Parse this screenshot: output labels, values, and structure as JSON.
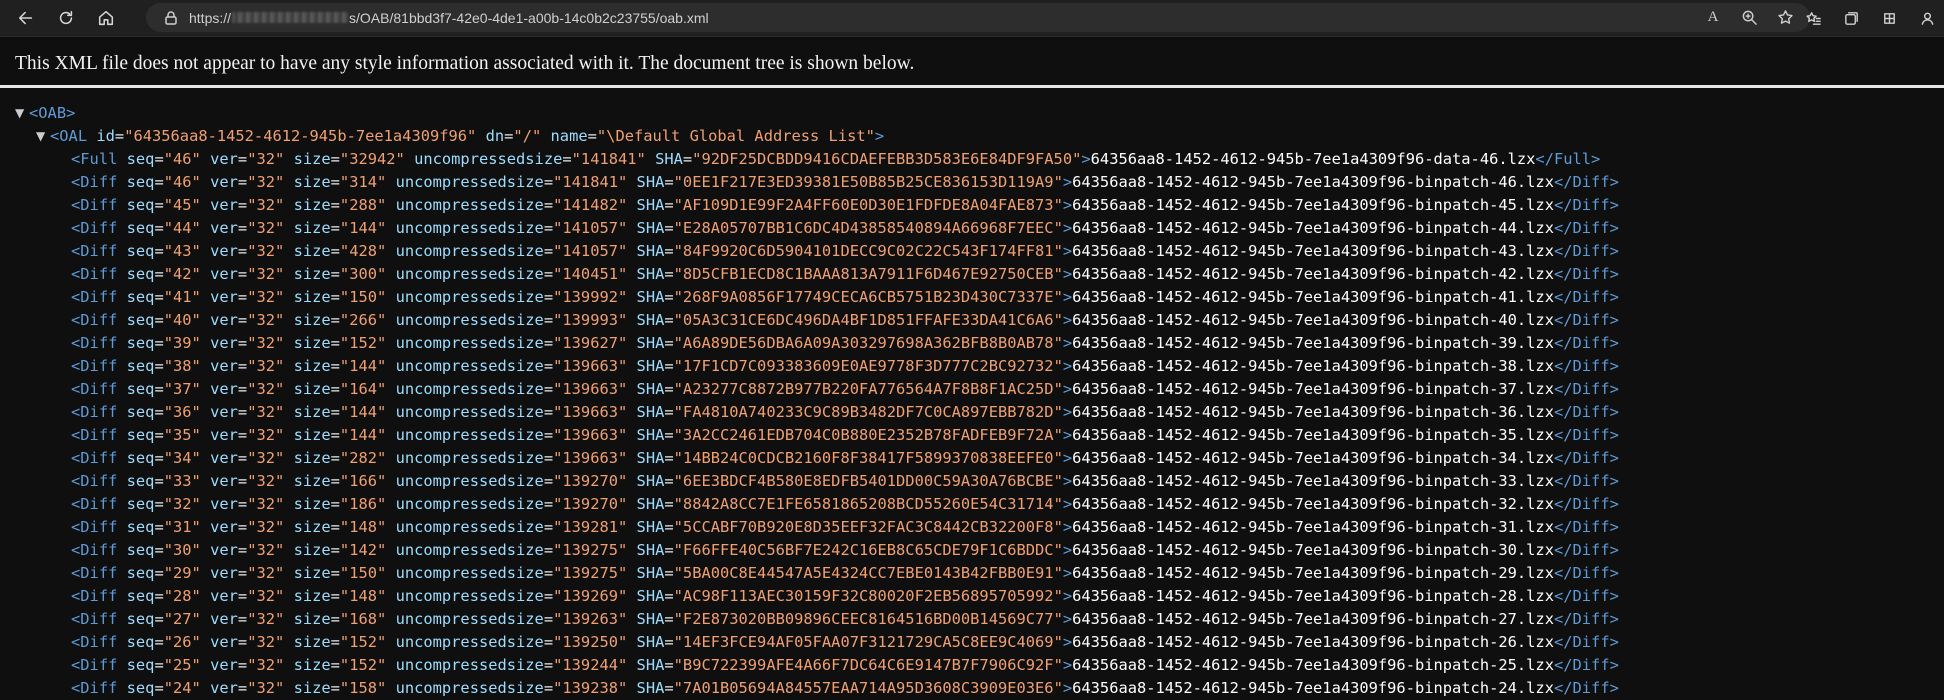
{
  "browser": {
    "url_prefix": "https://",
    "url_suffix": "s/OAB/81bbd3f7-42e0-4de1-a00b-14c0b2c23755/oab.xml",
    "read_aloud_label": "A"
  },
  "notice": "This XML file does not appear to have any style information associated with it. The document tree is shown below.",
  "xml": {
    "root_tag": "OAB",
    "oal": {
      "tag": "OAL",
      "id": "64356aa8-1452-4612-945b-7ee1a4309f96",
      "dn": "/",
      "name": "\\Default Global Address List"
    },
    "entries": [
      {
        "tag": "Full",
        "seq": "46",
        "ver": "32",
        "size": "32942",
        "uncompressedsize": "141841",
        "SHA": "92DF25DCBDD9416CDAEFEBB3D583E6E84DF9FA50",
        "text": "64356aa8-1452-4612-945b-7ee1a4309f96-data-46.lzx"
      },
      {
        "tag": "Diff",
        "seq": "46",
        "ver": "32",
        "size": "314",
        "uncompressedsize": "141841",
        "SHA": "0EE1F217E3ED39381E50B85B25CE836153D119A9",
        "text": "64356aa8-1452-4612-945b-7ee1a4309f96-binpatch-46.lzx"
      },
      {
        "tag": "Diff",
        "seq": "45",
        "ver": "32",
        "size": "288",
        "uncompressedsize": "141482",
        "SHA": "AF109D1E99F2A4FF60E0D30E1FDFDE8A04FAE873",
        "text": "64356aa8-1452-4612-945b-7ee1a4309f96-binpatch-45.lzx"
      },
      {
        "tag": "Diff",
        "seq": "44",
        "ver": "32",
        "size": "144",
        "uncompressedsize": "141057",
        "SHA": "E28A05707BB1C6DC4D43858540894A66968F7EEC",
        "text": "64356aa8-1452-4612-945b-7ee1a4309f96-binpatch-44.lzx"
      },
      {
        "tag": "Diff",
        "seq": "43",
        "ver": "32",
        "size": "428",
        "uncompressedsize": "141057",
        "SHA": "84F9920C6D5904101DECC9C02C22C543F174FF81",
        "text": "64356aa8-1452-4612-945b-7ee1a4309f96-binpatch-43.lzx"
      },
      {
        "tag": "Diff",
        "seq": "42",
        "ver": "32",
        "size": "300",
        "uncompressedsize": "140451",
        "SHA": "8D5CFB1ECD8C1BAAA813A7911F6D467E92750CEB",
        "text": "64356aa8-1452-4612-945b-7ee1a4309f96-binpatch-42.lzx"
      },
      {
        "tag": "Diff",
        "seq": "41",
        "ver": "32",
        "size": "150",
        "uncompressedsize": "139992",
        "SHA": "268F9A0856F17749CECA6CB5751B23D430C7337E",
        "text": "64356aa8-1452-4612-945b-7ee1a4309f96-binpatch-41.lzx"
      },
      {
        "tag": "Diff",
        "seq": "40",
        "ver": "32",
        "size": "266",
        "uncompressedsize": "139993",
        "SHA": "05A3C31CE6DC496DA4BF1D851FFAFE33DA41C6A6",
        "text": "64356aa8-1452-4612-945b-7ee1a4309f96-binpatch-40.lzx"
      },
      {
        "tag": "Diff",
        "seq": "39",
        "ver": "32",
        "size": "152",
        "uncompressedsize": "139627",
        "SHA": "A6A89DE56DBA6A09A303297698A362BFB8B0AB78",
        "text": "64356aa8-1452-4612-945b-7ee1a4309f96-binpatch-39.lzx"
      },
      {
        "tag": "Diff",
        "seq": "38",
        "ver": "32",
        "size": "144",
        "uncompressedsize": "139663",
        "SHA": "17F1CD7C093383609E0AE9778F3D777C2BC92732",
        "text": "64356aa8-1452-4612-945b-7ee1a4309f96-binpatch-38.lzx"
      },
      {
        "tag": "Diff",
        "seq": "37",
        "ver": "32",
        "size": "164",
        "uncompressedsize": "139663",
        "SHA": "A23277C8872B977B220FA776564A7F8B8F1AC25D",
        "text": "64356aa8-1452-4612-945b-7ee1a4309f96-binpatch-37.lzx"
      },
      {
        "tag": "Diff",
        "seq": "36",
        "ver": "32",
        "size": "144",
        "uncompressedsize": "139663",
        "SHA": "FA4810A740233C9C89B3482DF7C0CA897EBB782D",
        "text": "64356aa8-1452-4612-945b-7ee1a4309f96-binpatch-36.lzx"
      },
      {
        "tag": "Diff",
        "seq": "35",
        "ver": "32",
        "size": "144",
        "uncompressedsize": "139663",
        "SHA": "3A2CC2461EDB704C0B880E2352B78FADFEB9F72A",
        "text": "64356aa8-1452-4612-945b-7ee1a4309f96-binpatch-35.lzx"
      },
      {
        "tag": "Diff",
        "seq": "34",
        "ver": "32",
        "size": "282",
        "uncompressedsize": "139663",
        "SHA": "14BB24C0CDCB2160F8F38417F5899370838EEFE0",
        "text": "64356aa8-1452-4612-945b-7ee1a4309f96-binpatch-34.lzx"
      },
      {
        "tag": "Diff",
        "seq": "33",
        "ver": "32",
        "size": "166",
        "uncompressedsize": "139270",
        "SHA": "6EE3BDCF4B580E8EDFB5401DD00C59A30A76BCBE",
        "text": "64356aa8-1452-4612-945b-7ee1a4309f96-binpatch-33.lzx"
      },
      {
        "tag": "Diff",
        "seq": "32",
        "ver": "32",
        "size": "186",
        "uncompressedsize": "139270",
        "SHA": "8842A8CC7E1FE6581865208BCD55260E54C31714",
        "text": "64356aa8-1452-4612-945b-7ee1a4309f96-binpatch-32.lzx"
      },
      {
        "tag": "Diff",
        "seq": "31",
        "ver": "32",
        "size": "148",
        "uncompressedsize": "139281",
        "SHA": "5CCABF70B920E8D35EEF32FAC3C8442CB32200F8",
        "text": "64356aa8-1452-4612-945b-7ee1a4309f96-binpatch-31.lzx"
      },
      {
        "tag": "Diff",
        "seq": "30",
        "ver": "32",
        "size": "142",
        "uncompressedsize": "139275",
        "SHA": "F66FFE40C56BF7E242C16EB8C65CDE79F1C6BDDC",
        "text": "64356aa8-1452-4612-945b-7ee1a4309f96-binpatch-30.lzx"
      },
      {
        "tag": "Diff",
        "seq": "29",
        "ver": "32",
        "size": "150",
        "uncompressedsize": "139275",
        "SHA": "5BA00C8E44547A5E4324CC7EBE0143B42FBB0E91",
        "text": "64356aa8-1452-4612-945b-7ee1a4309f96-binpatch-29.lzx"
      },
      {
        "tag": "Diff",
        "seq": "28",
        "ver": "32",
        "size": "148",
        "uncompressedsize": "139269",
        "SHA": "AC98F113AEC30159F32C80020F2EB56895705992",
        "text": "64356aa8-1452-4612-945b-7ee1a4309f96-binpatch-28.lzx"
      },
      {
        "tag": "Diff",
        "seq": "27",
        "ver": "32",
        "size": "168",
        "uncompressedsize": "139263",
        "SHA": "F2E873020BB09896CEEC8164516BD00B14569C77",
        "text": "64356aa8-1452-4612-945b-7ee1a4309f96-binpatch-27.lzx"
      },
      {
        "tag": "Diff",
        "seq": "26",
        "ver": "32",
        "size": "152",
        "uncompressedsize": "139250",
        "SHA": "14EF3FCE94AF05FAA07F3121729CA5C8EE9C4069",
        "text": "64356aa8-1452-4612-945b-7ee1a4309f96-binpatch-26.lzx"
      },
      {
        "tag": "Diff",
        "seq": "25",
        "ver": "32",
        "size": "152",
        "uncompressedsize": "139244",
        "SHA": "B9C722399AFE4A66F7DC64C6E9147B7F7906C92F",
        "text": "64356aa8-1452-4612-945b-7ee1a4309f96-binpatch-25.lzx"
      },
      {
        "tag": "Diff",
        "seq": "24",
        "ver": "32",
        "size": "158",
        "uncompressedsize": "139238",
        "SHA": "7A01B05694A84557EAA714A95D3608C3909E03E6",
        "text": "64356aa8-1452-4612-945b-7ee1a4309f96-binpatch-24.lzx"
      }
    ]
  },
  "colors": {
    "page_bg": "#0f0f0f",
    "tag": "#5d9bd8",
    "attr_name": "#9cdcfe",
    "attr_value": "#f0a070",
    "text": "#ffffff"
  }
}
